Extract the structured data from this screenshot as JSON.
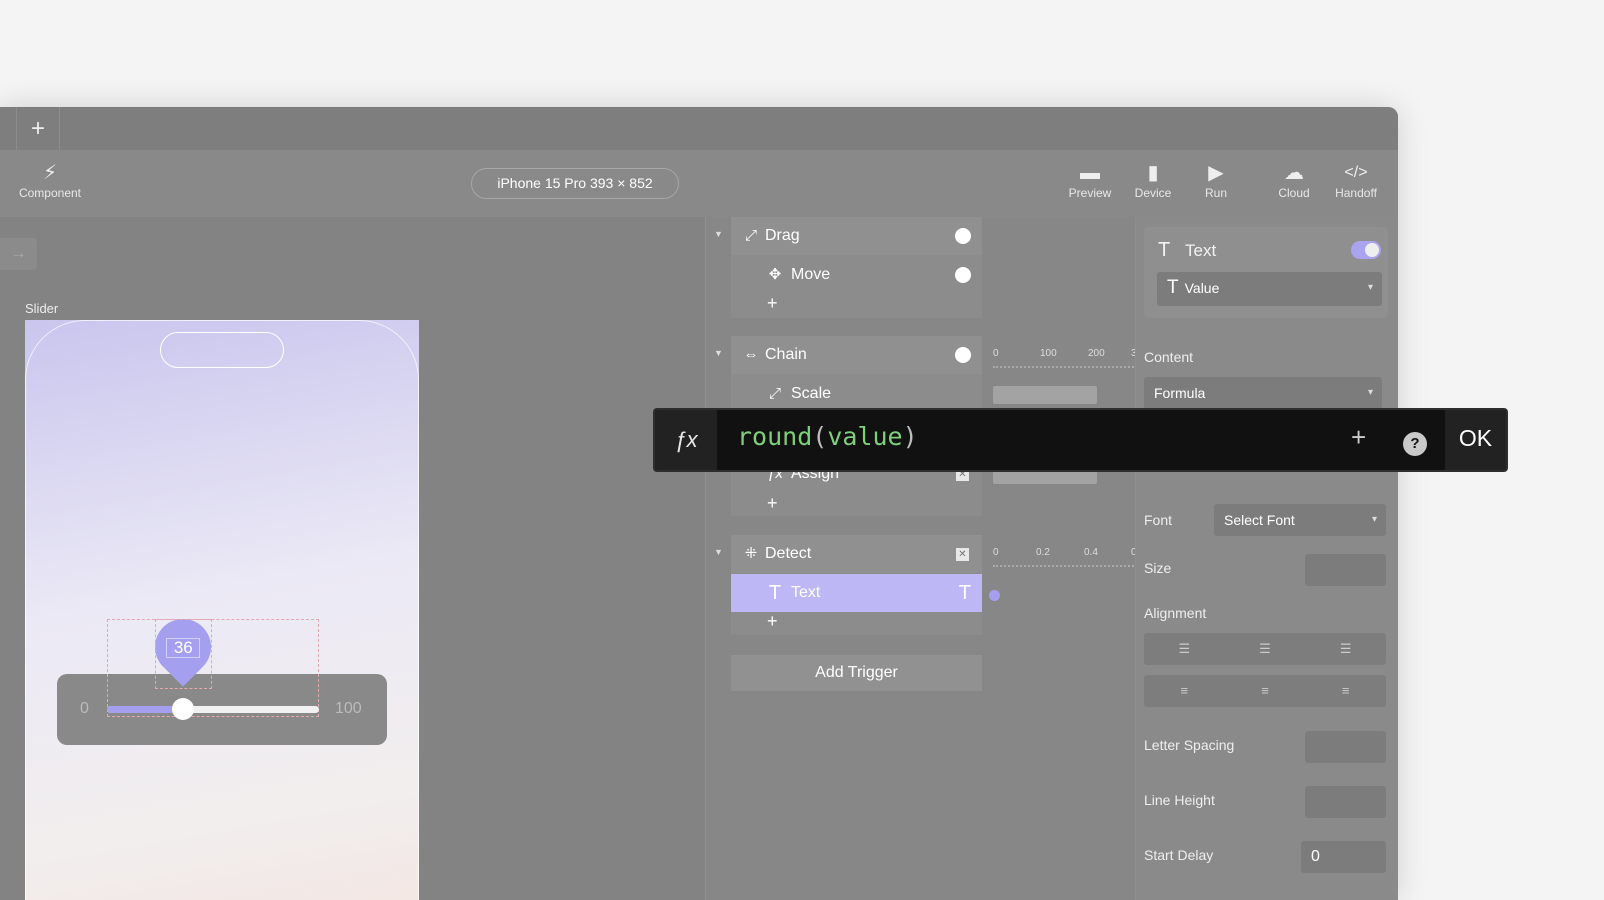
{
  "tabbar": {
    "new_tab_icon": "plus-icon"
  },
  "toolbar": {
    "component": "Component",
    "device_label": "iPhone 15 Pro  393 × 852",
    "buttons": [
      {
        "label": "Preview",
        "icon": "preview-icon"
      },
      {
        "label": "Device",
        "icon": "device-icon"
      },
      {
        "label": "Run",
        "icon": "play-icon"
      },
      {
        "label": "Cloud",
        "icon": "cloud-icon"
      },
      {
        "label": "Handoff",
        "icon": "code-icon"
      }
    ]
  },
  "canvas": {
    "frame_label": "Slider",
    "slider": {
      "min": "0",
      "max": "100",
      "value": "36",
      "value_fraction": 0.36
    },
    "accent": "#a59ff0"
  },
  "interactions": {
    "groups": [
      {
        "trigger": "Drag",
        "children": [
          "Move"
        ]
      },
      {
        "trigger": "Chain",
        "children": [
          "Scale",
          "Assign"
        ],
        "ruler": [
          "0",
          "100",
          "200",
          "3"
        ]
      },
      {
        "trigger": "Detect",
        "children": [
          "Text"
        ],
        "ruler": [
          "0",
          "0.2",
          "0.4",
          "0"
        ]
      }
    ],
    "add_trigger": "Add Trigger"
  },
  "properties": {
    "layer_title": "Text",
    "layer_toggle_on": true,
    "property": "Value",
    "content_label": "Content",
    "content_value": "Formula",
    "font_label": "Font",
    "font_value": "Select Font",
    "size_label": "Size",
    "alignment_label": "Alignment",
    "letter_spacing_label": "Letter Spacing",
    "line_height_label": "Line Height",
    "start_delay_label": "Start Delay",
    "start_delay_value": "0"
  },
  "formula": {
    "fn": "round",
    "open": "(",
    "arg": "value",
    "close": ")",
    "ok": "OK",
    "help": "?",
    "add": "+"
  }
}
